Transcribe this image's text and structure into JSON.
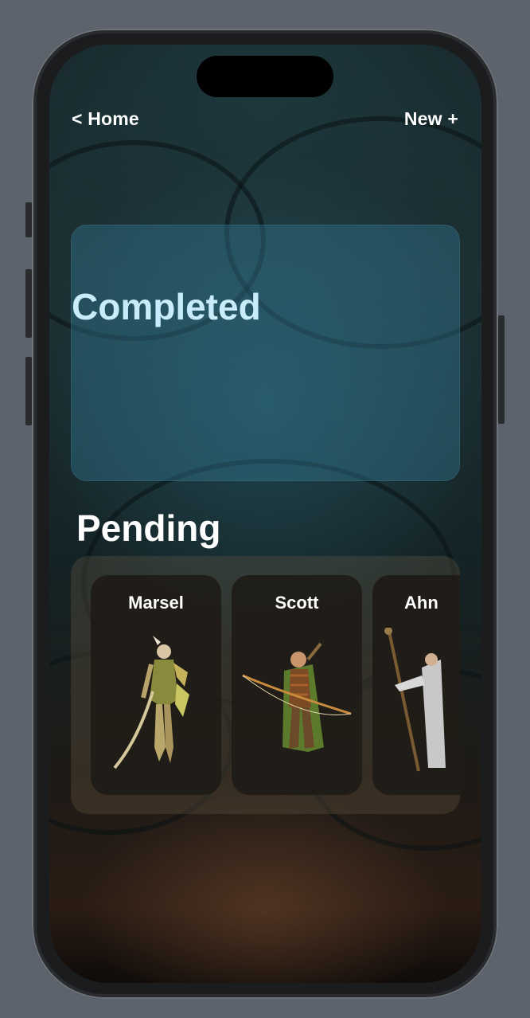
{
  "nav": {
    "back_label": "< Home",
    "new_label": "New +"
  },
  "completed": {
    "title": "Completed"
  },
  "pending": {
    "title": "Pending",
    "characters": [
      {
        "name": "Marsel",
        "icon": "elf-warrior-figure"
      },
      {
        "name": "Scott",
        "icon": "archer-figure"
      },
      {
        "name": "Ahn",
        "icon": "wizard-figure"
      }
    ]
  },
  "colors": {
    "completed_title": "#c9ecfb",
    "completed_card": "#32788f",
    "pending_card": "#1e1a16"
  }
}
